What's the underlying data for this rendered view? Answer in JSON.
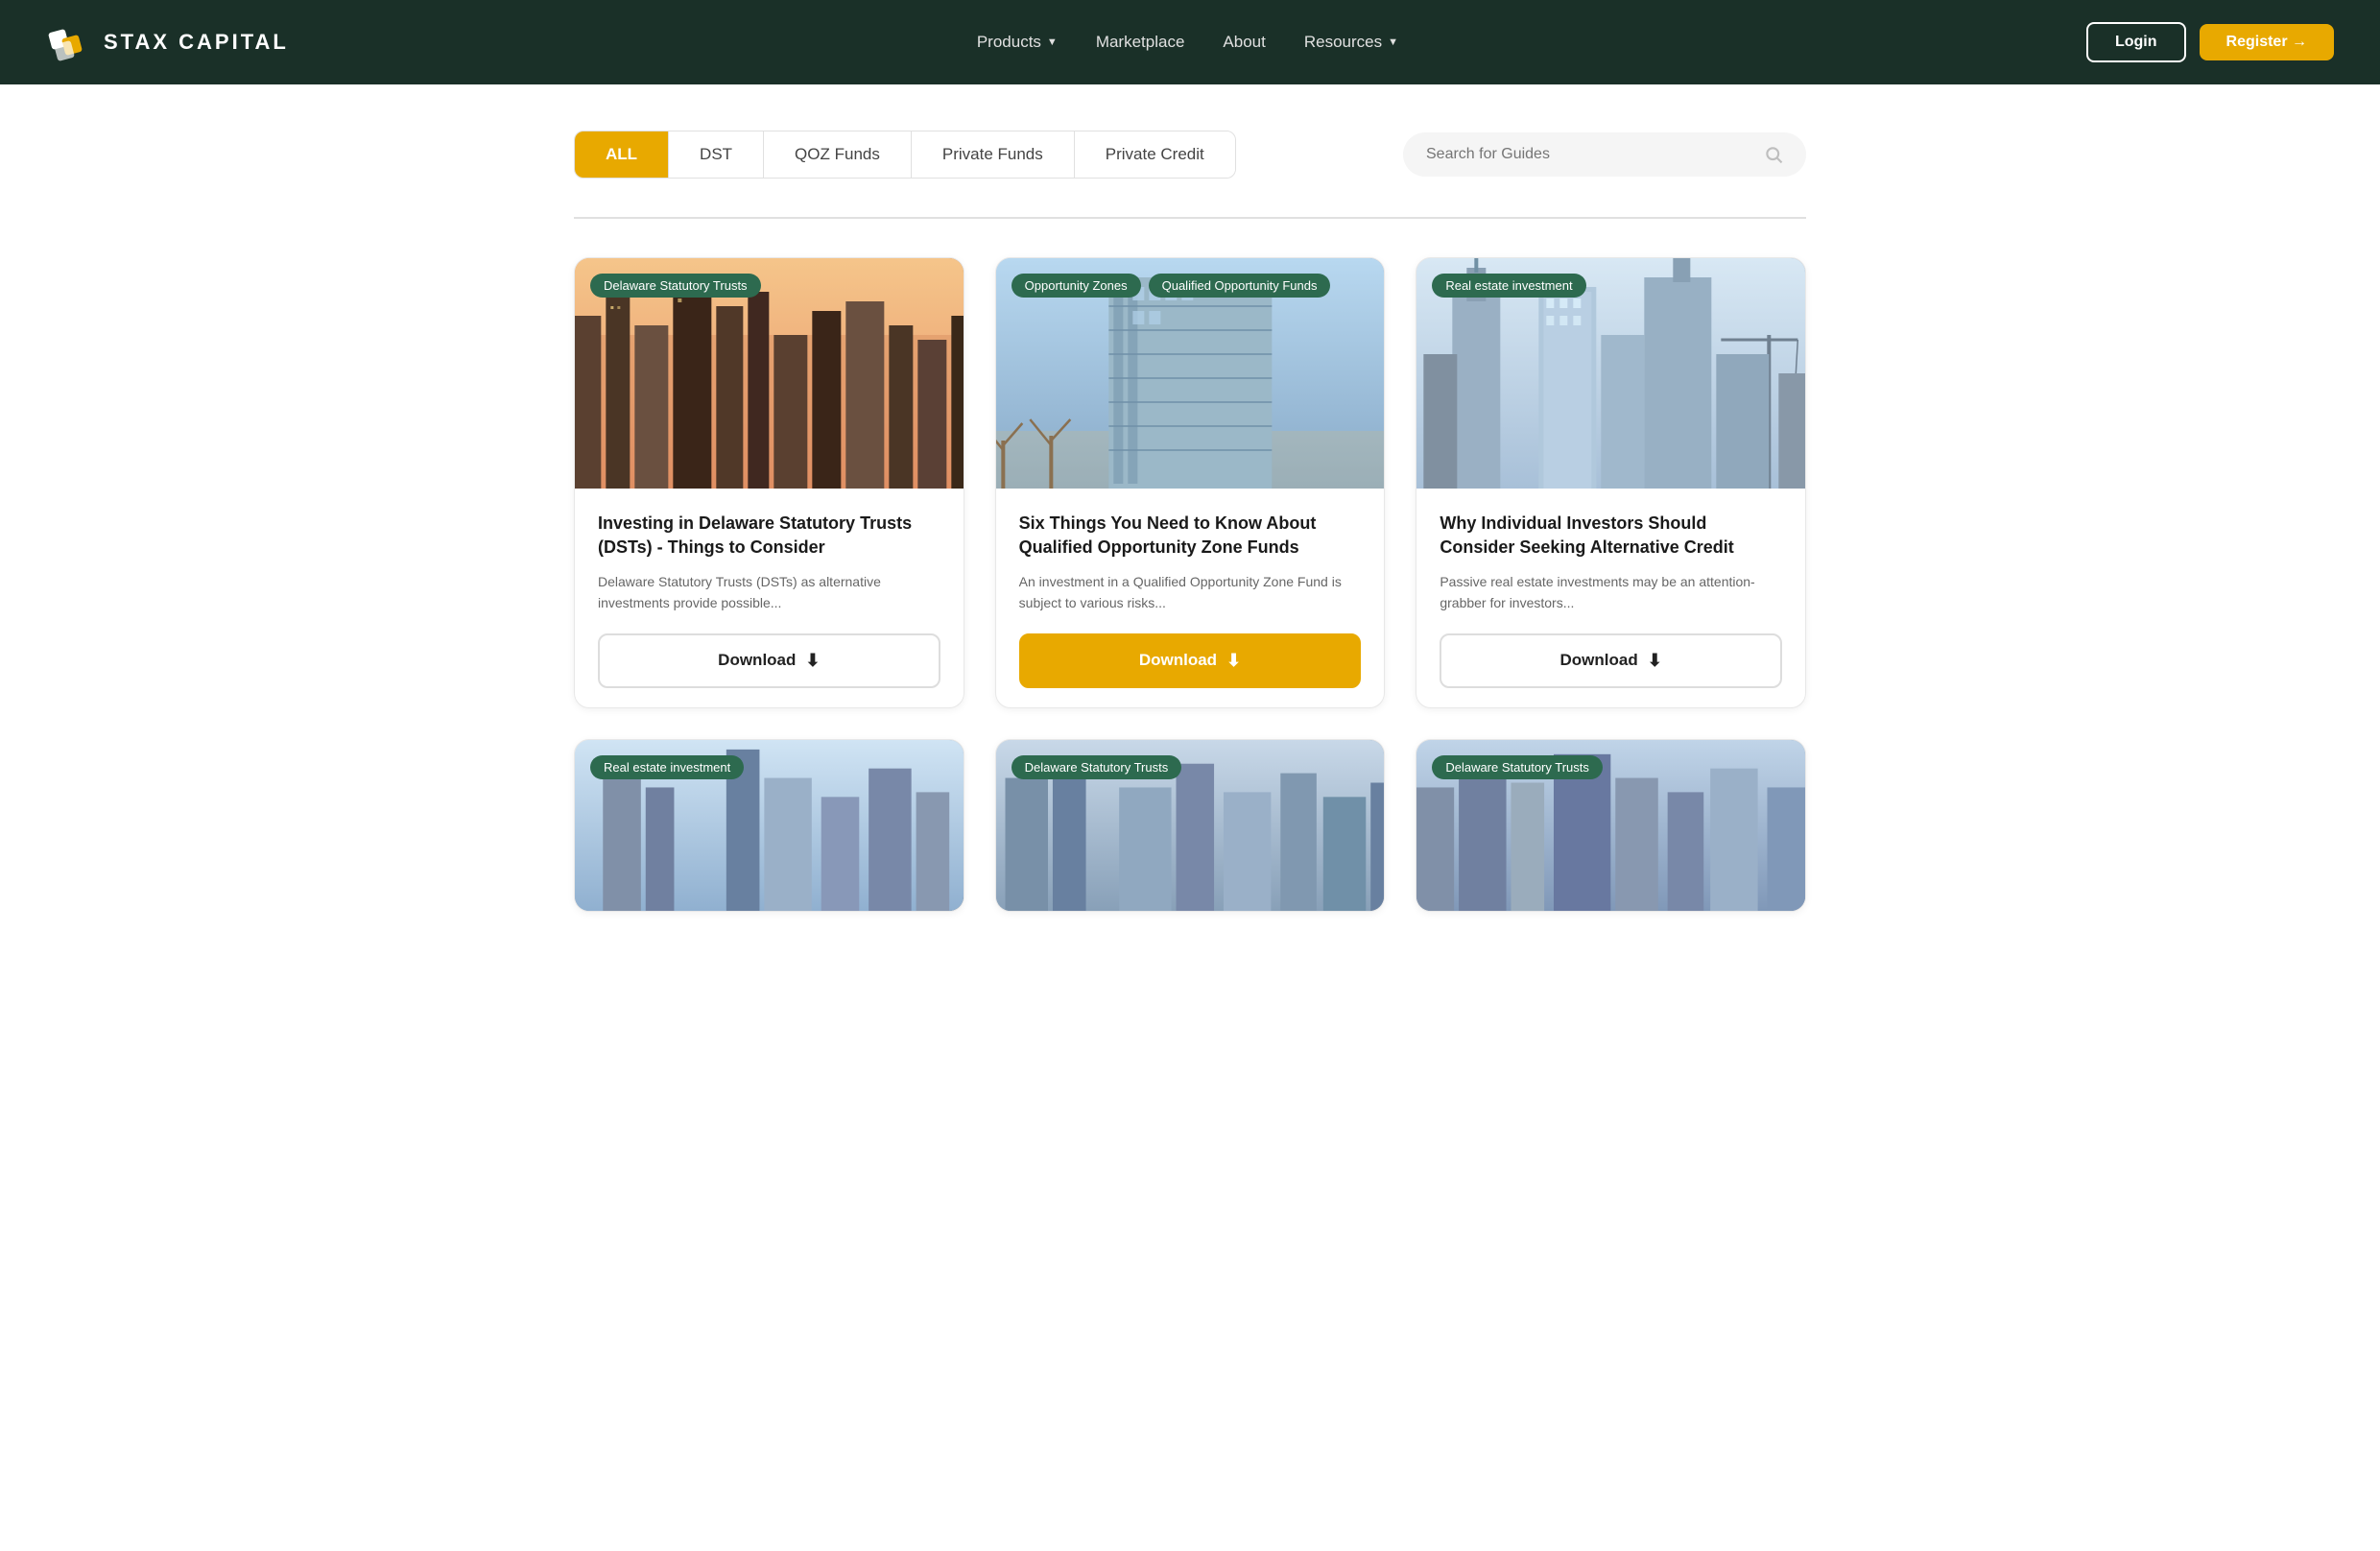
{
  "navbar": {
    "logo_text": "STAX CAPITAL",
    "links": [
      {
        "label": "Products",
        "has_dropdown": true
      },
      {
        "label": "Marketplace",
        "has_dropdown": false
      },
      {
        "label": "About",
        "has_dropdown": false
      },
      {
        "label": "Resources",
        "has_dropdown": true
      }
    ],
    "login_label": "Login",
    "register_label": "Register →"
  },
  "filters": {
    "tabs": [
      {
        "label": "ALL",
        "active": true
      },
      {
        "label": "DST",
        "active": false
      },
      {
        "label": "QOZ Funds",
        "active": false
      },
      {
        "label": "Private Funds",
        "active": false
      },
      {
        "label": "Private Credit",
        "active": false
      }
    ],
    "search_placeholder": "Search for Guides"
  },
  "cards": [
    {
      "tags": [
        "Delaware Statutory Trusts"
      ],
      "title": "Investing in Delaware Statutory Trusts (DSTs) - Things to Consider",
      "excerpt": "Delaware Statutory Trusts (DSTs) as alternative investments provide possible...",
      "download_label": "Download",
      "highlighted": false,
      "image_class": "img-city1"
    },
    {
      "tags": [
        "Opportunity Zones",
        "Qualified Opportunity Funds"
      ],
      "title": "Six Things You Need to Know About Qualified Opportunity Zone Funds",
      "excerpt": "An investment in a Qualified Opportunity Zone Fund is subject to various risks...",
      "download_label": "Download",
      "highlighted": true,
      "image_class": "img-city2"
    },
    {
      "tags": [
        "Real estate investment"
      ],
      "title": "Why Individual Investors Should Consider Seeking Alternative Credit",
      "excerpt": "Passive real estate investments may be an attention-grabber for investors...",
      "download_label": "Download",
      "highlighted": false,
      "image_class": "img-city3"
    }
  ],
  "bottom_cards": [
    {
      "tags": [
        "Real estate investment"
      ],
      "image_class": "img-partial1",
      "label": "Real estate investment"
    },
    {
      "tags": [
        "Delaware Statutory Trusts"
      ],
      "image_class": "img-partial2",
      "label": "Delaware Statutory Trusts"
    },
    {
      "tags": [
        "Delaware Statutory Trusts"
      ],
      "image_class": "img-partial3",
      "label": "Delaware Statutory Trusts"
    }
  ]
}
